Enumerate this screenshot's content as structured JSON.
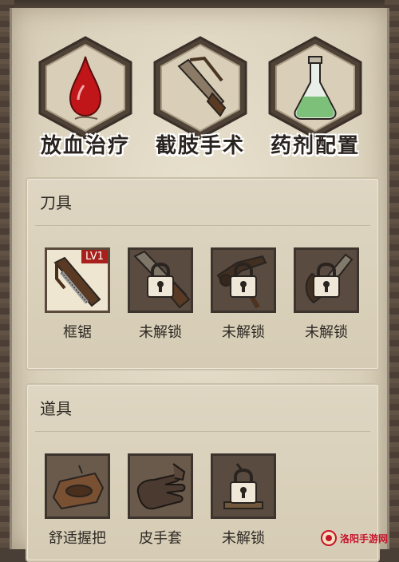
{
  "categories": [
    {
      "label": "放血治疗",
      "icon": "blood-drop-icon"
    },
    {
      "label": "截肢手术",
      "icon": "saw-icon"
    },
    {
      "label": "药剂配置",
      "icon": "flask-icon"
    }
  ],
  "tools_section": {
    "title": "刀具",
    "items": [
      {
        "label": "框锯",
        "badge": "LV1",
        "state": "selected",
        "icon": "frame-saw-icon"
      },
      {
        "label": "未解锁",
        "state": "locked",
        "icon": "hand-saw-icon"
      },
      {
        "label": "未解锁",
        "state": "locked",
        "icon": "pliers-icon"
      },
      {
        "label": "未解锁",
        "state": "locked",
        "icon": "bone-saw-icon"
      }
    ]
  },
  "props_section": {
    "title": "道具",
    "items": [
      {
        "label": "舒适握把",
        "state": "unlocked",
        "icon": "grip-icon"
      },
      {
        "label": "皮手套",
        "state": "unlocked",
        "icon": "leather-glove-icon"
      },
      {
        "label": "未解锁",
        "state": "locked",
        "icon": "unknown-item-icon"
      }
    ]
  },
  "watermark": {
    "text": "洛阳手游网"
  },
  "colors": {
    "accent": "#a8201c",
    "parchment": "#e3dbc7",
    "frame": "#4a3f36"
  }
}
